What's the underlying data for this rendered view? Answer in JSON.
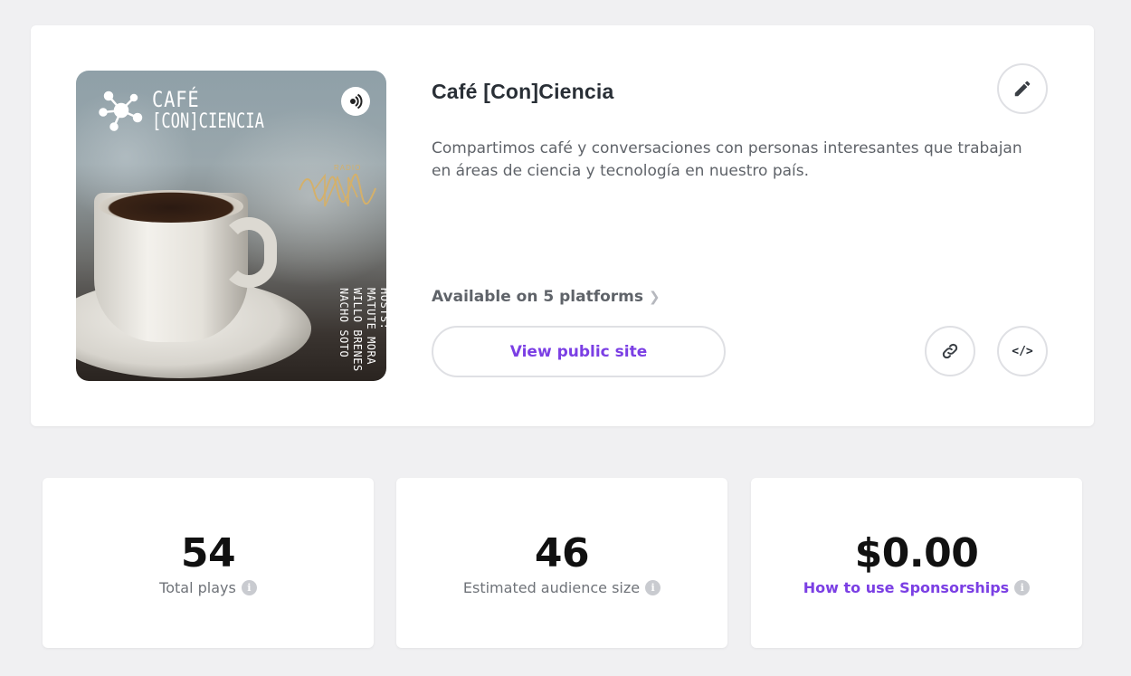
{
  "podcast": {
    "title": "Café [Con]Ciencia",
    "description": "Compartimos café y conversaciones con personas interesantes que trabajan en áreas de ciencia y tecnología en nuestro país.",
    "platforms_label": "Available on 5 platforms",
    "view_public_site_label": "View public site",
    "cover": {
      "brand_line1": "CAFÉ",
      "brand_line2": "[CON]CIENCIA",
      "radio_label": "RADIO",
      "hosts_text": "HOSTS: MATUTE MORA WILLO BRENES NACHO SOTO"
    },
    "icons": {
      "edit": "pencil-icon",
      "link": "link-icon",
      "embed": "code-icon",
      "chevron": "chevron-right-icon",
      "info": "info-icon"
    }
  },
  "stats": [
    {
      "value": "54",
      "label": "Total plays"
    },
    {
      "value": "46",
      "label": "Estimated audience size"
    },
    {
      "value": "$0.00",
      "label": "How to use Sponsorships"
    }
  ],
  "colors": {
    "accent": "#7b3fe4",
    "background": "#f0f0f2",
    "card": "#ffffff"
  }
}
